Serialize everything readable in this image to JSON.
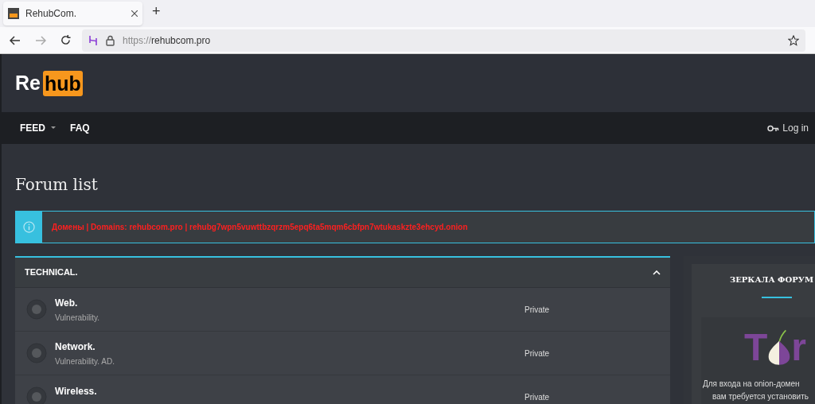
{
  "browser": {
    "tab_title": "RehubCom.",
    "new_tab": "+",
    "url_prefix": "https://",
    "url_host": "rehubcom.pro"
  },
  "logo": {
    "left": "Re",
    "right": "hub"
  },
  "nav": [
    {
      "label": "FEED",
      "dropdown": true
    },
    {
      "label": "FAQ",
      "dropdown": false
    }
  ],
  "login": "Log in",
  "page_title": "Forum list",
  "notice": "Домены | Domains: rehubcom.pro | rehubg7wpn5vuwttbzqrzm5epq6ta5mqm6cbfpn7wtukaskzte3ehcyd.onion",
  "category": {
    "title": "TECHNICAL.",
    "expanded": true,
    "forums": [
      {
        "title": "Web.",
        "description": "Vulnerability.",
        "status": "Private"
      },
      {
        "title": "Network.",
        "description": "Vulnerability. AD.",
        "status": "Private"
      },
      {
        "title": "Wireless.",
        "status": "Private"
      }
    ]
  },
  "sidebar": {
    "title": "ЗЕРКАЛА ФОРУМ",
    "tor_logo": {
      "left": "T",
      "right": "r"
    },
    "text_lines": [
      "Для входа на onion-домен",
      "вам требуется установить"
    ]
  }
}
